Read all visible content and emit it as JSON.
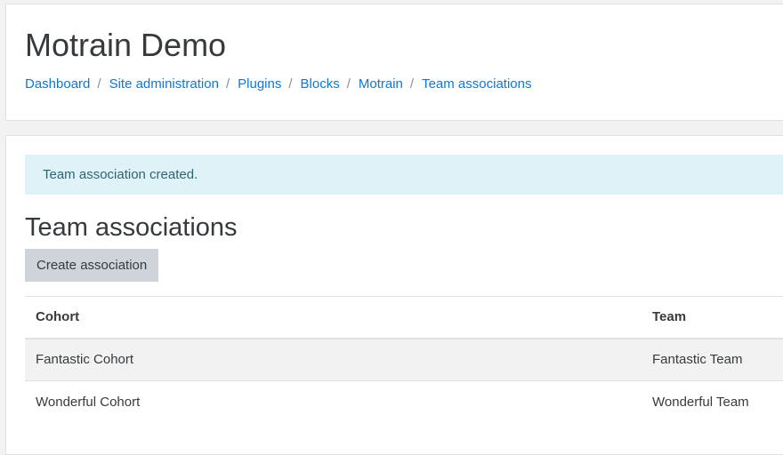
{
  "header": {
    "site_title": "Motrain Demo",
    "breadcrumb": [
      {
        "label": "Dashboard"
      },
      {
        "label": "Site administration"
      },
      {
        "label": "Plugins"
      },
      {
        "label": "Blocks"
      },
      {
        "label": "Motrain"
      },
      {
        "label": "Team associations"
      }
    ],
    "separator": "/"
  },
  "main": {
    "alert_message": "Team association created.",
    "section_title": "Team associations",
    "create_button_label": "Create association",
    "table": {
      "columns": [
        "Cohort",
        "Team"
      ],
      "rows": [
        {
          "cohort": "Fantastic Cohort",
          "team": "Fantastic Team"
        },
        {
          "cohort": "Wonderful Cohort",
          "team": "Wonderful Team"
        }
      ]
    }
  },
  "colors": {
    "link": "#1177d1",
    "alert_background": "#def2f8",
    "alert_text": "#2f6473",
    "button_background": "#ced4da",
    "striped_row": "#f2f2f2"
  }
}
